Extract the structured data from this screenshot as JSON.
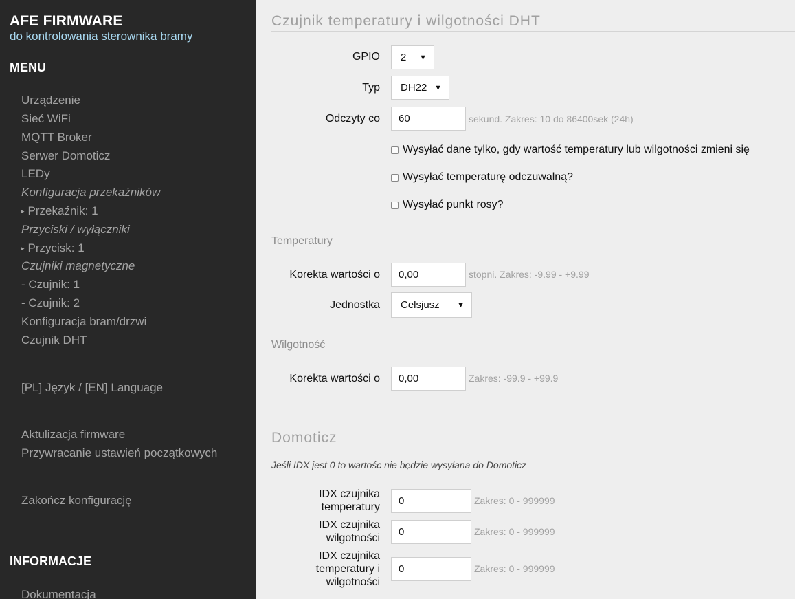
{
  "brand": {
    "title": "AFE FIRMWARE",
    "subtitle": "do kontrolowania sterownika bramy"
  },
  "sidebar": {
    "menu_heading": "MENU",
    "items": [
      "Urządzenie",
      "Sieć WiFi",
      "MQTT Broker",
      "Serwer Domoticz",
      "LEDy",
      "Konfiguracja przekaźników",
      "Przekaźnik: 1",
      "Przyciski / wyłączniki",
      "Przycisk: 1",
      "Czujniki magnetyczne",
      "- Czujnik: 1",
      "- Czujnik: 2",
      "Konfiguracja bram/drzwi",
      "Czujnik DHT"
    ],
    "language": "[PL] Język / [EN] Language",
    "firmware_update": "Aktulizacja firmware",
    "factory_reset": "Przywracanie ustawień początkowych",
    "finish": "Zakończ konfigurację",
    "info_heading": "INFORMACJE",
    "documentation": "Dokumentacja"
  },
  "dht": {
    "title": "Czujnik temperatury i wilgotności DHT",
    "gpio": {
      "label": "GPIO",
      "value": "2"
    },
    "type": {
      "label": "Typ",
      "value": "DH22"
    },
    "interval": {
      "label": "Odczyty co",
      "value": "60",
      "hint": "sekund. Zakres: 10 do 86400sek (24h)"
    },
    "checkboxes": [
      {
        "label": "Wysyłać dane tylko, gdy wartość temperatury lub wilgotności zmieni się",
        "checked": false
      },
      {
        "label": "Wysyłać temperaturę odczuwalną?",
        "checked": false
      },
      {
        "label": "Wysyłać punkt rosy?",
        "checked": false
      }
    ],
    "temperature": {
      "heading": "Temperatury",
      "correction": {
        "label": "Korekta wartości o",
        "value": "0,00",
        "hint": "stopni. Zakres: -9.99 - +9.99"
      },
      "unit": {
        "label": "Jednostka",
        "value": "Celsjusz"
      }
    },
    "humidity": {
      "heading": "Wilgotność",
      "correction": {
        "label": "Korekta wartości o",
        "value": "0,00",
        "hint": "Zakres: -99.9 - +99.9"
      }
    }
  },
  "domoticz": {
    "title": "Domoticz",
    "note": "Jeśli IDX jest 0 to wartośc nie będzie wysyłana do Domoticz",
    "fields": [
      {
        "label_lines": [
          "IDX czujnika",
          "temperatury"
        ],
        "value": "0",
        "hint": "Zakres: 0 - 999999"
      },
      {
        "label_lines": [
          "IDX czujnika",
          "wilgotności"
        ],
        "value": "0",
        "hint": "Zakres: 0 - 999999"
      },
      {
        "label_lines": [
          "IDX czujnika",
          "temperatury i",
          "wilgotności"
        ],
        "value": "0",
        "hint": "Zakres: 0 - 999999"
      }
    ]
  },
  "icons": {
    "select_arrow": "dropdown-arrow-icon",
    "list_bullet": "triangle-bullet-icon"
  },
  "colors": {
    "sidebar_bg": "#282828",
    "content_bg": "#eeeeee",
    "subtitle": "#a8d8f0",
    "nav_text": "#a3a3a3"
  }
}
